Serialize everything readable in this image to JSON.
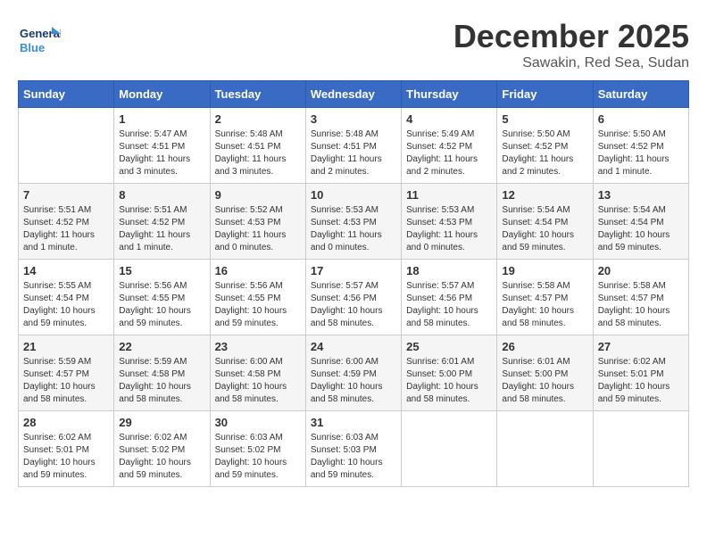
{
  "header": {
    "logo_text_1": "General",
    "logo_text_2": "Blue",
    "month": "December 2025",
    "location": "Sawakin, Red Sea, Sudan"
  },
  "days_of_week": [
    "Sunday",
    "Monday",
    "Tuesday",
    "Wednesday",
    "Thursday",
    "Friday",
    "Saturday"
  ],
  "weeks": [
    [
      {
        "day": "",
        "info": ""
      },
      {
        "day": "1",
        "info": "Sunrise: 5:47 AM\nSunset: 4:51 PM\nDaylight: 11 hours\nand 3 minutes."
      },
      {
        "day": "2",
        "info": "Sunrise: 5:48 AM\nSunset: 4:51 PM\nDaylight: 11 hours\nand 3 minutes."
      },
      {
        "day": "3",
        "info": "Sunrise: 5:48 AM\nSunset: 4:51 PM\nDaylight: 11 hours\nand 2 minutes."
      },
      {
        "day": "4",
        "info": "Sunrise: 5:49 AM\nSunset: 4:52 PM\nDaylight: 11 hours\nand 2 minutes."
      },
      {
        "day": "5",
        "info": "Sunrise: 5:50 AM\nSunset: 4:52 PM\nDaylight: 11 hours\nand 2 minutes."
      },
      {
        "day": "6",
        "info": "Sunrise: 5:50 AM\nSunset: 4:52 PM\nDaylight: 11 hours\nand 1 minute."
      }
    ],
    [
      {
        "day": "7",
        "info": "Sunrise: 5:51 AM\nSunset: 4:52 PM\nDaylight: 11 hours\nand 1 minute."
      },
      {
        "day": "8",
        "info": "Sunrise: 5:51 AM\nSunset: 4:52 PM\nDaylight: 11 hours\nand 1 minute."
      },
      {
        "day": "9",
        "info": "Sunrise: 5:52 AM\nSunset: 4:53 PM\nDaylight: 11 hours\nand 0 minutes."
      },
      {
        "day": "10",
        "info": "Sunrise: 5:53 AM\nSunset: 4:53 PM\nDaylight: 11 hours\nand 0 minutes."
      },
      {
        "day": "11",
        "info": "Sunrise: 5:53 AM\nSunset: 4:53 PM\nDaylight: 11 hours\nand 0 minutes."
      },
      {
        "day": "12",
        "info": "Sunrise: 5:54 AM\nSunset: 4:54 PM\nDaylight: 10 hours\nand 59 minutes."
      },
      {
        "day": "13",
        "info": "Sunrise: 5:54 AM\nSunset: 4:54 PM\nDaylight: 10 hours\nand 59 minutes."
      }
    ],
    [
      {
        "day": "14",
        "info": "Sunrise: 5:55 AM\nSunset: 4:54 PM\nDaylight: 10 hours\nand 59 minutes."
      },
      {
        "day": "15",
        "info": "Sunrise: 5:56 AM\nSunset: 4:55 PM\nDaylight: 10 hours\nand 59 minutes."
      },
      {
        "day": "16",
        "info": "Sunrise: 5:56 AM\nSunset: 4:55 PM\nDaylight: 10 hours\nand 59 minutes."
      },
      {
        "day": "17",
        "info": "Sunrise: 5:57 AM\nSunset: 4:56 PM\nDaylight: 10 hours\nand 58 minutes."
      },
      {
        "day": "18",
        "info": "Sunrise: 5:57 AM\nSunset: 4:56 PM\nDaylight: 10 hours\nand 58 minutes."
      },
      {
        "day": "19",
        "info": "Sunrise: 5:58 AM\nSunset: 4:57 PM\nDaylight: 10 hours\nand 58 minutes."
      },
      {
        "day": "20",
        "info": "Sunrise: 5:58 AM\nSunset: 4:57 PM\nDaylight: 10 hours\nand 58 minutes."
      }
    ],
    [
      {
        "day": "21",
        "info": "Sunrise: 5:59 AM\nSunset: 4:57 PM\nDaylight: 10 hours\nand 58 minutes."
      },
      {
        "day": "22",
        "info": "Sunrise: 5:59 AM\nSunset: 4:58 PM\nDaylight: 10 hours\nand 58 minutes."
      },
      {
        "day": "23",
        "info": "Sunrise: 6:00 AM\nSunset: 4:58 PM\nDaylight: 10 hours\nand 58 minutes."
      },
      {
        "day": "24",
        "info": "Sunrise: 6:00 AM\nSunset: 4:59 PM\nDaylight: 10 hours\nand 58 minutes."
      },
      {
        "day": "25",
        "info": "Sunrise: 6:01 AM\nSunset: 5:00 PM\nDaylight: 10 hours\nand 58 minutes."
      },
      {
        "day": "26",
        "info": "Sunrise: 6:01 AM\nSunset: 5:00 PM\nDaylight: 10 hours\nand 58 minutes."
      },
      {
        "day": "27",
        "info": "Sunrise: 6:02 AM\nSunset: 5:01 PM\nDaylight: 10 hours\nand 59 minutes."
      }
    ],
    [
      {
        "day": "28",
        "info": "Sunrise: 6:02 AM\nSunset: 5:01 PM\nDaylight: 10 hours\nand 59 minutes."
      },
      {
        "day": "29",
        "info": "Sunrise: 6:02 AM\nSunset: 5:02 PM\nDaylight: 10 hours\nand 59 minutes."
      },
      {
        "day": "30",
        "info": "Sunrise: 6:03 AM\nSunset: 5:02 PM\nDaylight: 10 hours\nand 59 minutes."
      },
      {
        "day": "31",
        "info": "Sunrise: 6:03 AM\nSunset: 5:03 PM\nDaylight: 10 hours\nand 59 minutes."
      },
      {
        "day": "",
        "info": ""
      },
      {
        "day": "",
        "info": ""
      },
      {
        "day": "",
        "info": ""
      }
    ]
  ]
}
